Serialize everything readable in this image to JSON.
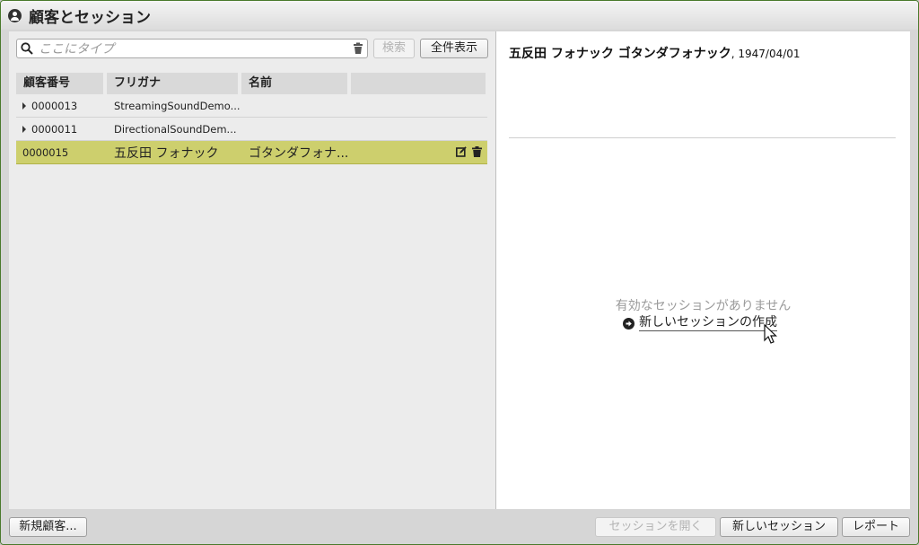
{
  "window": {
    "title": "顧客とセッション"
  },
  "search": {
    "placeholder": "ここにタイプ",
    "value": ""
  },
  "buttons": {
    "search": "検索",
    "show_all": "全件表示",
    "new_customer": "新規顧客...",
    "open_session": "セッションを開く",
    "new_session": "新しいセッション",
    "report": "レポート"
  },
  "table": {
    "headers": [
      "顧客番号",
      "フリガナ",
      "名前",
      ""
    ],
    "rows": [
      {
        "id": "0000013",
        "furigana": "StreamingSoundDemo...",
        "name": "",
        "expandable": true,
        "selected": false
      },
      {
        "id": "0000011",
        "furigana": "DirectionalSoundDem...",
        "name": "",
        "expandable": true,
        "selected": false
      },
      {
        "id": "0000015",
        "furigana": "五反田 フォナック",
        "name": "ゴタンダフォナ...",
        "expandable": false,
        "selected": true
      }
    ]
  },
  "detail": {
    "customer_name": "五反田 フォナック ゴタンダフォナック",
    "birthdate": ", 1947/04/01",
    "no_session_text": "有効なセッションがありません",
    "create_session_link": "新しいセッションの作成"
  },
  "colors": {
    "selected_row": "#cdcf6d",
    "window_border": "#4a7a2c"
  },
  "icons": [
    "user-icon",
    "search-icon",
    "clear-icon",
    "edit-icon",
    "trash-icon",
    "arrow-circle-icon",
    "mouse-cursor-icon"
  ]
}
